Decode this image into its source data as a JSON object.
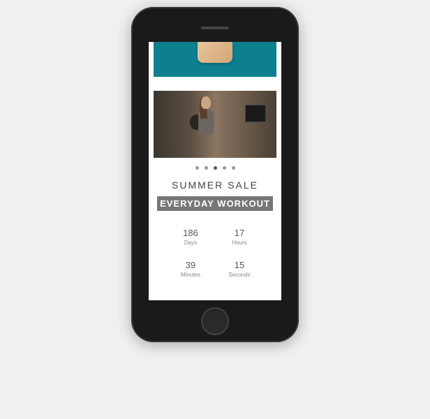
{
  "hero": {
    "label": "hero-banner"
  },
  "carousel": {
    "dots_count": 5,
    "active_index": 2
  },
  "sale": {
    "heading": "SUMMER SALE",
    "title": "EVERYDAY WORKOUT"
  },
  "countdown": {
    "items": [
      {
        "value": "186",
        "label": "Days"
      },
      {
        "value": "17",
        "label": "Hours"
      },
      {
        "value": "39",
        "label": "Minutes"
      },
      {
        "value": "15",
        "label": "Seconds"
      }
    ]
  }
}
